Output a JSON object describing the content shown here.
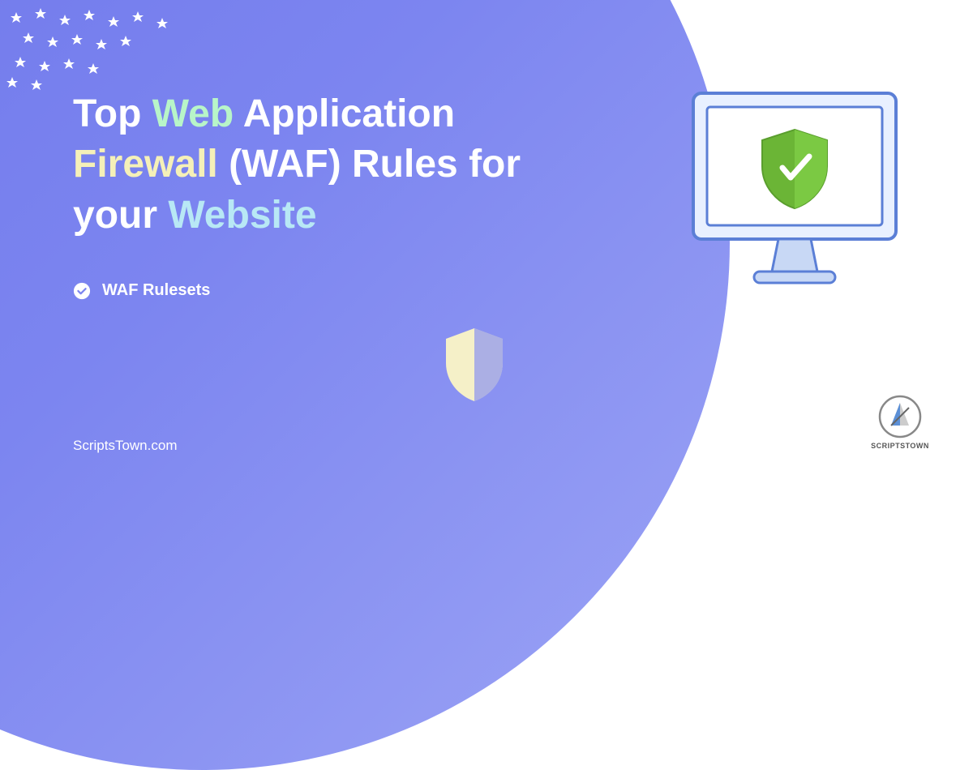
{
  "title": {
    "part1": "Top ",
    "web": "Web",
    "part2": " Application ",
    "firewall": "Firewall",
    "part3": " (WAF) Rules for your ",
    "website": "Website"
  },
  "subtitle": "WAF Rulesets",
  "site": "ScriptsTown.com",
  "logo_text": "SCRIPTSTOWN",
  "colors": {
    "bg_purple": "#7c85f0",
    "accent_green": "#b8f5c8",
    "accent_yellow": "#f5f0b8",
    "accent_cyan": "#b8e8f5",
    "shield_cream": "#f5f0c8",
    "monitor_blue": "#5b7fd6",
    "shield_green": "#7bc943"
  }
}
